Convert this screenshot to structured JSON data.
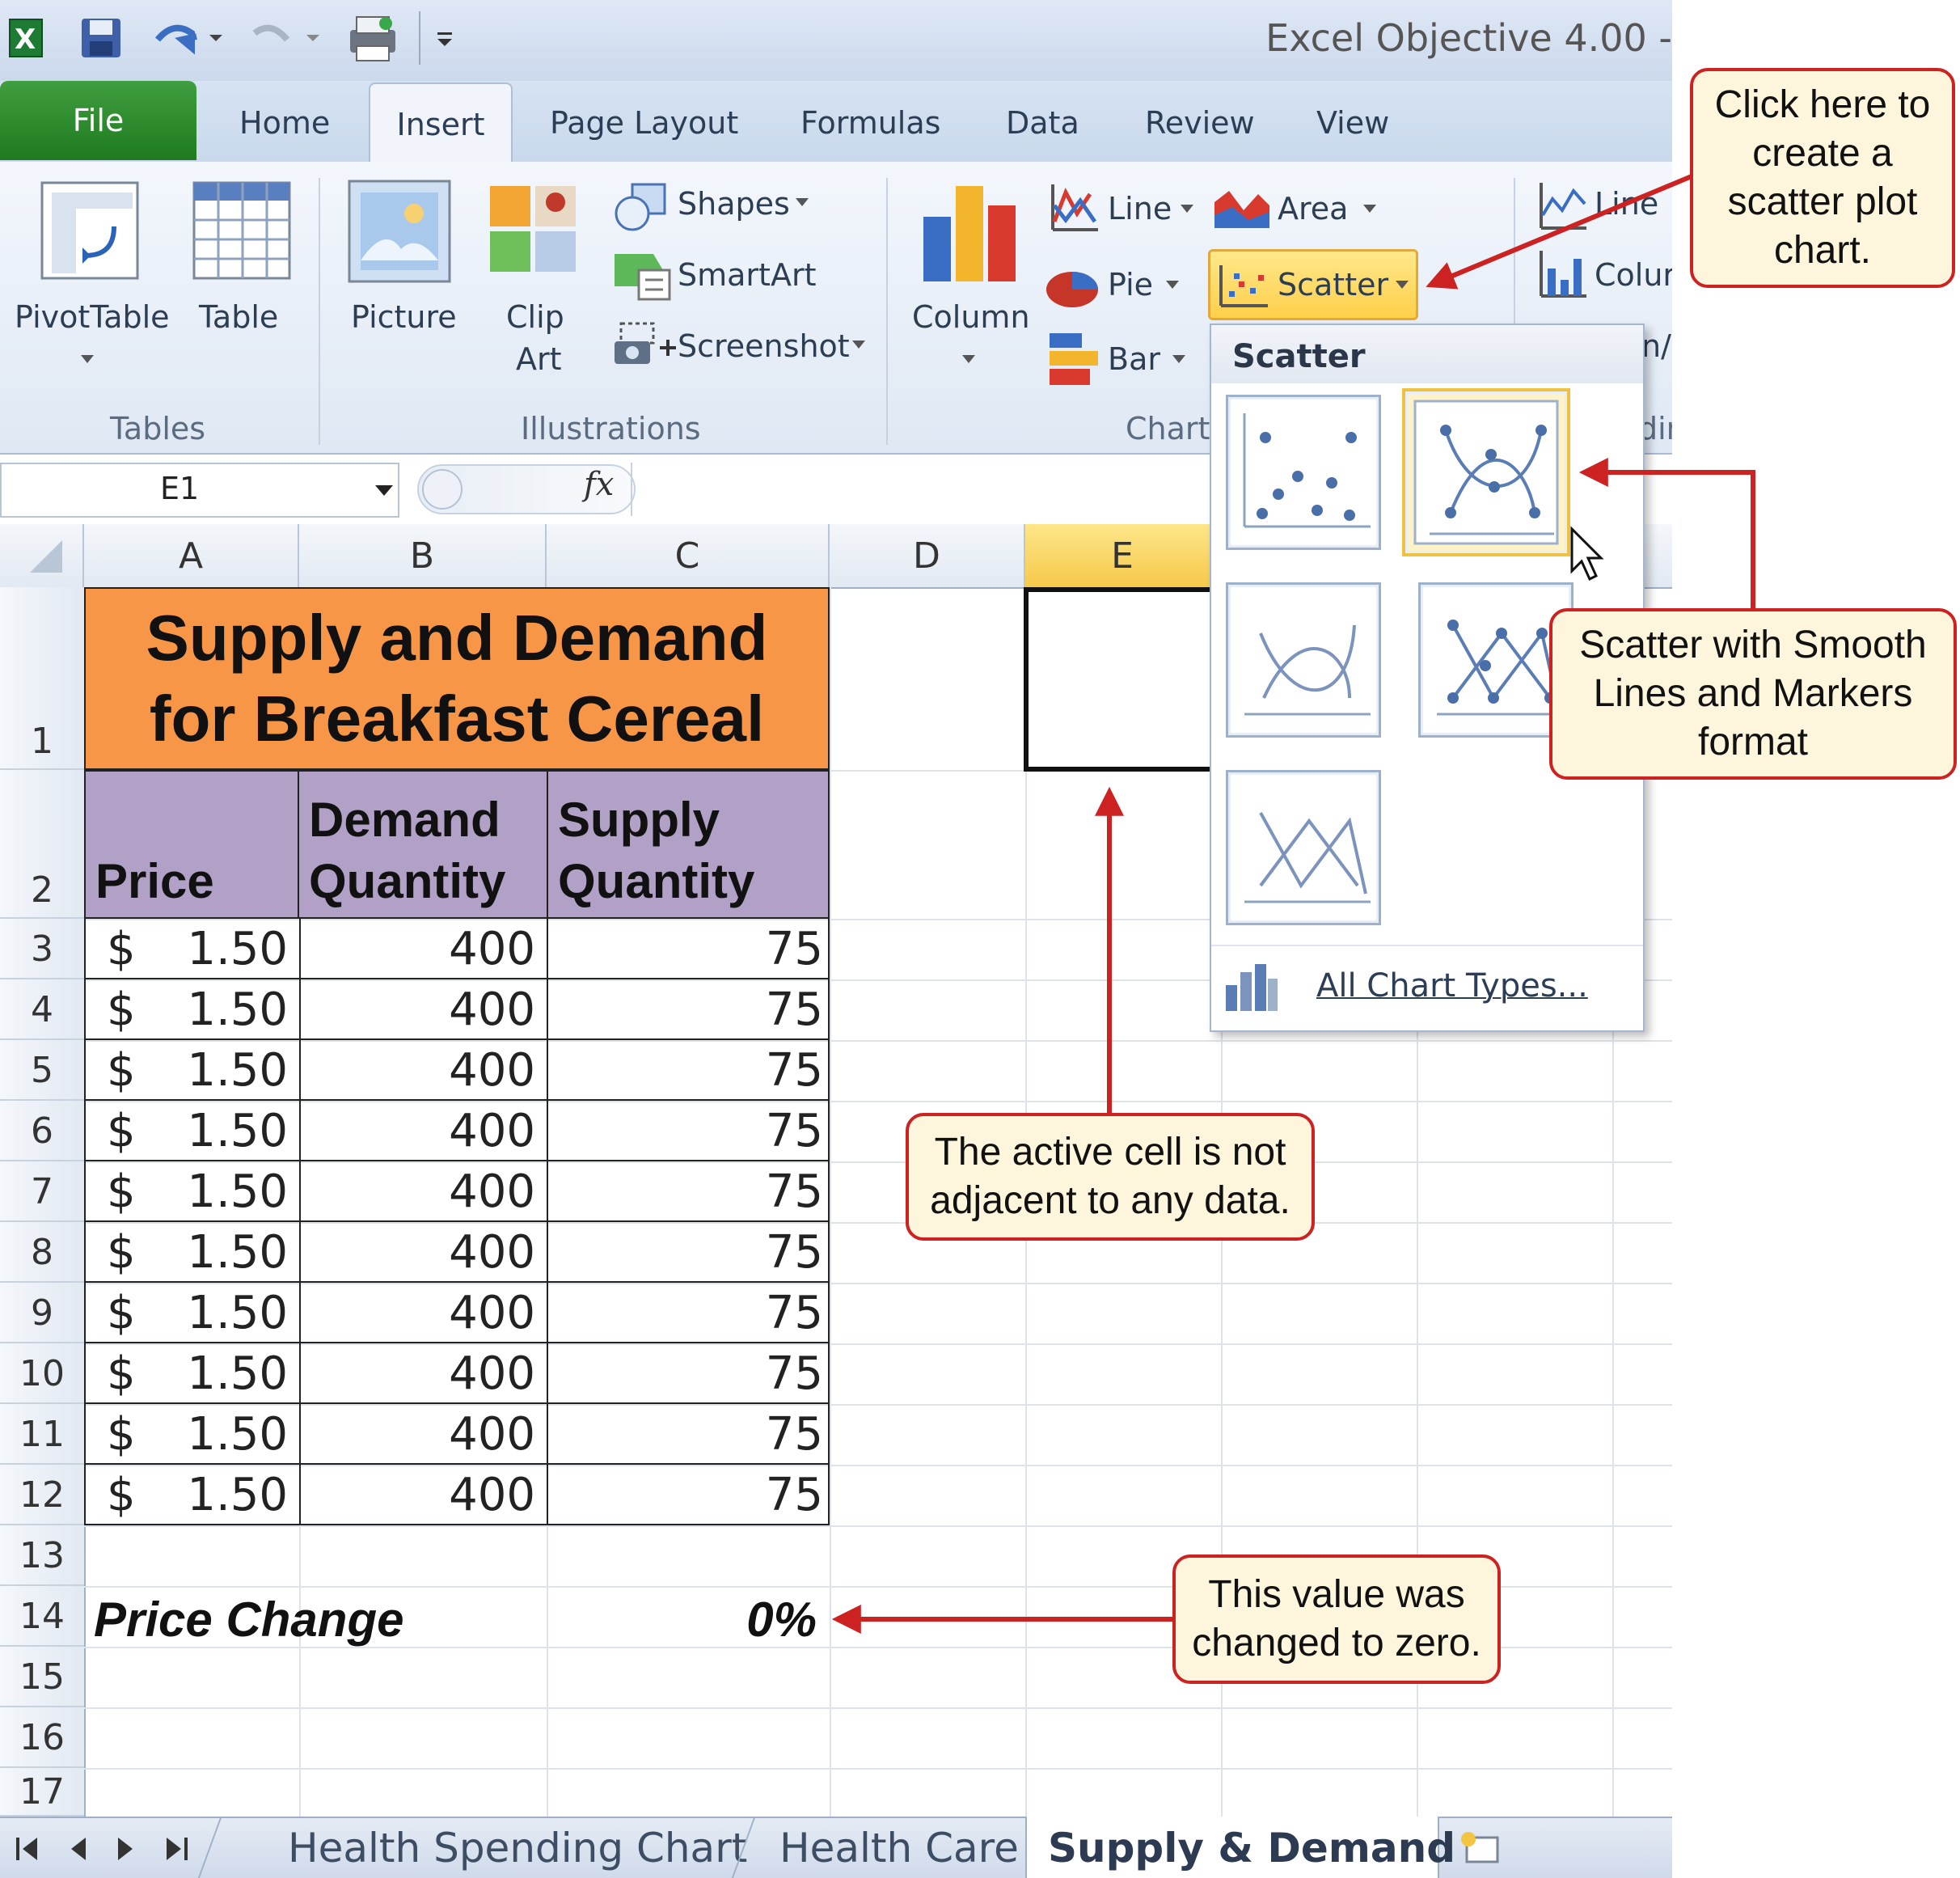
{
  "window": {
    "title": "Excel Objective 4.00 -"
  },
  "tabs": [
    {
      "label": "File"
    },
    {
      "label": "Home"
    },
    {
      "label": "Insert"
    },
    {
      "label": "Page Layout"
    },
    {
      "label": "Formulas"
    },
    {
      "label": "Data"
    },
    {
      "label": "Review"
    },
    {
      "label": "View"
    }
  ],
  "ribbon": {
    "tables": {
      "pivottable": "PivotTable",
      "table": "Table",
      "group": "Tables"
    },
    "illustrations": {
      "picture": "Picture",
      "clip_art_1": "Clip",
      "clip_art_2": "Art",
      "shapes": "Shapes",
      "smartart": "SmartArt",
      "screenshot": "Screenshot",
      "group": "Illustrations"
    },
    "charts": {
      "column": "Column",
      "line": "Line",
      "pie": "Pie",
      "bar": "Bar",
      "area": "Area",
      "scatter": "Scatter",
      "group": "Charts"
    },
    "sparklines": {
      "line": "Line",
      "column": "Colur",
      "winloss": "n/l",
      "group": "dir"
    }
  },
  "formula_bar": {
    "name_box": "E1",
    "fx": "fx"
  },
  "columns": [
    "A",
    "B",
    "C",
    "D",
    "E"
  ],
  "rows": [
    "1",
    "2",
    "3",
    "4",
    "5",
    "6",
    "7",
    "8",
    "9",
    "10",
    "11",
    "12",
    "13",
    "14",
    "15",
    "16",
    "17"
  ],
  "sheet": {
    "title_line1": "Supply and Demand",
    "title_line2": "for Breakfast Cereal",
    "headers": {
      "price": "Price",
      "demand_1": "Demand",
      "demand_2": "Quantity",
      "supply_1": "Supply",
      "supply_2": "Quantity"
    },
    "data": [
      {
        "cur": "$",
        "price": "1.50",
        "demand": "400",
        "supply": "75"
      },
      {
        "cur": "$",
        "price": "1.50",
        "demand": "400",
        "supply": "75"
      },
      {
        "cur": "$",
        "price": "1.50",
        "demand": "400",
        "supply": "75"
      },
      {
        "cur": "$",
        "price": "1.50",
        "demand": "400",
        "supply": "75"
      },
      {
        "cur": "$",
        "price": "1.50",
        "demand": "400",
        "supply": "75"
      },
      {
        "cur": "$",
        "price": "1.50",
        "demand": "400",
        "supply": "75"
      },
      {
        "cur": "$",
        "price": "1.50",
        "demand": "400",
        "supply": "75"
      },
      {
        "cur": "$",
        "price": "1.50",
        "demand": "400",
        "supply": "75"
      },
      {
        "cur": "$",
        "price": "1.50",
        "demand": "400",
        "supply": "75"
      },
      {
        "cur": "$",
        "price": "1.50",
        "demand": "400",
        "supply": "75"
      }
    ],
    "price_change_label": "Price Change",
    "price_change_value": "0%"
  },
  "dropdown": {
    "header": "Scatter",
    "all_chart_types": "All Chart Types..."
  },
  "sheet_tabs": [
    {
      "label": "Health Spending Chart"
    },
    {
      "label": "Health Care"
    },
    {
      "label": "Supply & Demand"
    }
  ],
  "callouts": {
    "scatter": "Click here to create a scatter plot chart.",
    "format": "Scatter with Smooth Lines and Markers format",
    "active_cell": "The active cell is not adjacent to any data.",
    "value": "This value was changed to zero."
  },
  "colors": {
    "title_fill": "#f79646",
    "header_fill": "#b2a1c7",
    "callout_fill": "#fef6dc",
    "callout_border": "#cc2222",
    "file_tab": "#2e8b2e",
    "selection": "#f0c040"
  }
}
